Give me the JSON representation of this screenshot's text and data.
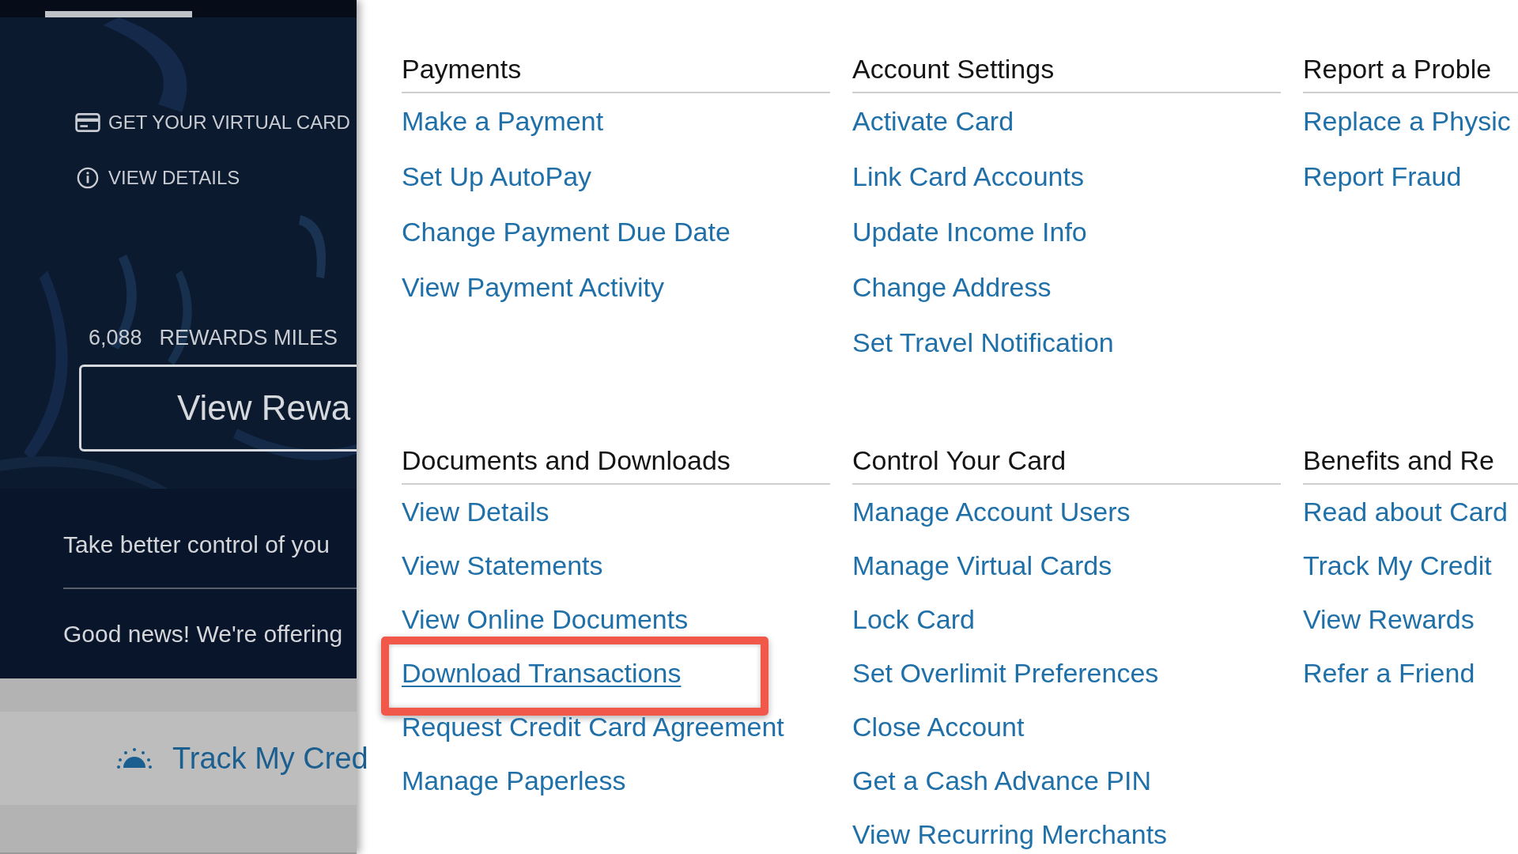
{
  "left_panel": {
    "card_actions": [
      {
        "kind": "card",
        "label": "GET YOUR VIRTUAL CARD"
      },
      {
        "kind": "info",
        "label": "VIEW DETAILS"
      }
    ],
    "rewards": {
      "value": "6,088",
      "label": "REWARDS MILES"
    },
    "rewards_button": "View Rewa",
    "messages": [
      "Take better control of you",
      "Good news! We're offering"
    ],
    "track_link": "Track My Cred"
  },
  "menu": {
    "sections": [
      {
        "heading": "Payments",
        "links": [
          {
            "label": "Make a Payment",
            "highlighted": false
          },
          {
            "label": "Set Up AutoPay",
            "highlighted": false
          },
          {
            "label": "Change Payment Due Date",
            "highlighted": false
          },
          {
            "label": "View Payment Activity",
            "highlighted": false
          }
        ]
      },
      {
        "heading": "Account Settings",
        "links": [
          {
            "label": "Activate Card",
            "highlighted": false
          },
          {
            "label": "Link Card Accounts",
            "highlighted": false
          },
          {
            "label": "Update Income Info",
            "highlighted": false
          },
          {
            "label": "Change Address",
            "highlighted": false
          },
          {
            "label": "Set Travel Notification",
            "highlighted": false
          }
        ]
      },
      {
        "heading": "Report a Proble",
        "links": [
          {
            "label": "Replace a Physic",
            "highlighted": false
          },
          {
            "label": "Report Fraud",
            "highlighted": false
          }
        ]
      },
      {
        "heading": "Documents and Downloads",
        "links": [
          {
            "label": "View Details",
            "highlighted": false
          },
          {
            "label": "View Statements",
            "highlighted": false
          },
          {
            "label": "View Online Documents",
            "highlighted": false
          },
          {
            "label": "Download Transactions",
            "highlighted": true
          },
          {
            "label": "Request Credit Card Agreement",
            "highlighted": false
          },
          {
            "label": "Manage Paperless",
            "highlighted": false
          }
        ]
      },
      {
        "heading": "Control Your Card",
        "links": [
          {
            "label": "Manage Account Users",
            "highlighted": false
          },
          {
            "label": "Manage Virtual Cards",
            "highlighted": false
          },
          {
            "label": "Lock Card",
            "highlighted": false
          },
          {
            "label": "Set Overlimit Preferences",
            "highlighted": false
          },
          {
            "label": "Close Account",
            "highlighted": false
          },
          {
            "label": "Get a Cash Advance PIN",
            "highlighted": false
          },
          {
            "label": "View Recurring Merchants",
            "highlighted": false
          }
        ]
      },
      {
        "heading": "Benefits and Re",
        "links": [
          {
            "label": "Read about Card",
            "highlighted": false
          },
          {
            "label": "Track My Credit",
            "highlighted": false
          },
          {
            "label": "View Rewards",
            "highlighted": false
          },
          {
            "label": "Refer a Friend",
            "highlighted": false
          }
        ]
      }
    ]
  }
}
